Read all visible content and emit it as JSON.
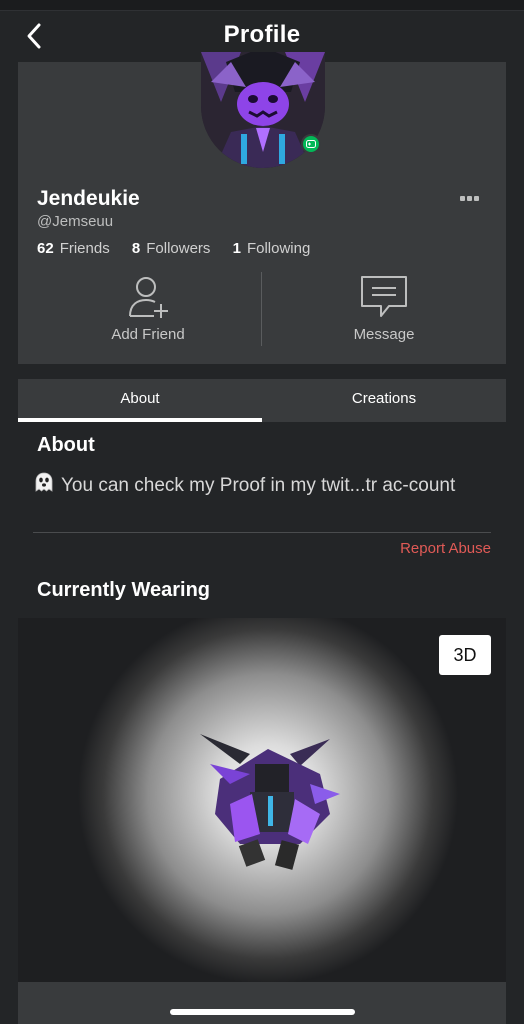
{
  "header": {
    "title": "Profile",
    "back_icon": "chevron-left-icon"
  },
  "profile": {
    "display_name": "Jendeukie",
    "username": "@Jemseuu",
    "presence": "in-game",
    "stats": [
      {
        "count": "62",
        "label": "Friends"
      },
      {
        "count": "8",
        "label": "Followers"
      },
      {
        "count": "1",
        "label": "Following"
      }
    ],
    "actions": {
      "add_friend": "Add Friend",
      "message": "Message"
    },
    "more_icon": "ellipsis-icon"
  },
  "tabs": [
    {
      "label": "About",
      "active": true
    },
    {
      "label": "Creations",
      "active": false
    }
  ],
  "about": {
    "title": "About",
    "text": "You can check my Proof in my twit...tr ac-count",
    "report": "Report Abuse"
  },
  "wearing": {
    "title": "Currently Wearing",
    "toggle_3d": "3D"
  },
  "colors": {
    "background": "#232527",
    "card": "#393b3d",
    "report": "#e05a56",
    "online": "#02b757"
  }
}
